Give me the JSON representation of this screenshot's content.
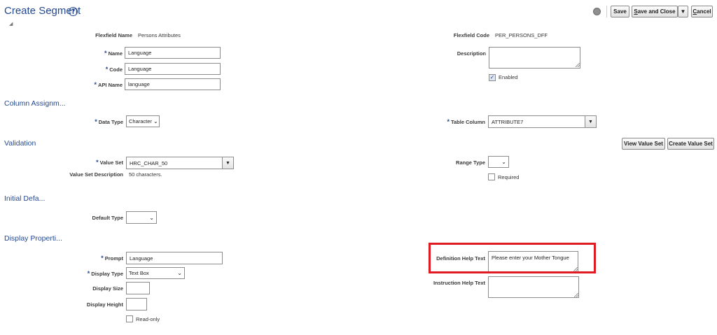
{
  "header": {
    "title": "Create Segment",
    "help_glyph": "?",
    "collapse_glyph": "◢",
    "buttons": {
      "save": "Save",
      "save_and_close": "ave and Close",
      "save_and_close_key": "S",
      "dropdown_glyph": "▼",
      "cancel": "ancel",
      "cancel_key": "C"
    }
  },
  "segment": {
    "flexfield_name_label": "Flexfield Name",
    "flexfield_name": "Persons Attributes",
    "flexfield_code_label": "Flexfield Code",
    "flexfield_code": "PER_PERSONS_DFF",
    "required_mark": "*",
    "name_label": "Name",
    "name_value": "Language",
    "code_label": "Code",
    "code_value": "Language",
    "api_name_label": "API Name",
    "api_name_value": "language",
    "description_label": "Description",
    "description_value": "",
    "enabled_label": "Enabled",
    "enabled_checked": true,
    "check_glyph": "✓"
  },
  "column_assignment": {
    "heading": "Column Assignm...",
    "data_type_label": "Data Type",
    "data_type_value": "Character",
    "table_column_label": "Table Column",
    "table_column_value": "ATTRIBUTE7"
  },
  "validation": {
    "heading": "Validation",
    "view_value_set": "View Value Set",
    "create_value_set": "Create Value Set",
    "value_set_label": "Value Set",
    "value_set_value": "HRC_CHAR_50",
    "value_set_description_label": "Value Set Description",
    "value_set_description": "50 characters.",
    "range_type_label": "Range Type",
    "range_type_value": "",
    "required_label": "Required",
    "required_checked": false
  },
  "initial_default": {
    "heading": "Initial Defa...",
    "default_type_label": "Default Type",
    "default_type_value": ""
  },
  "display_properties": {
    "heading": "Display Properti...",
    "prompt_label": "Prompt",
    "prompt_value": "Language",
    "display_type_label": "Display Type",
    "display_type_value": "Text Box",
    "display_size_label": "Display Size",
    "display_size_value": "",
    "display_height_label": "Display Height",
    "display_height_value": "",
    "read_only_label": "Read-only",
    "read_only_checked": false,
    "definition_help_label": "Definition Help Text",
    "definition_help_value": "Please enter your Mother Tongue",
    "instruction_help_label": "Instruction Help Text",
    "instruction_help_value": ""
  },
  "colors": {
    "accent": "#25498f",
    "highlight": "#e01b22"
  },
  "icons": {
    "select_chevron": "⌄",
    "lov_arrow": "▼"
  }
}
